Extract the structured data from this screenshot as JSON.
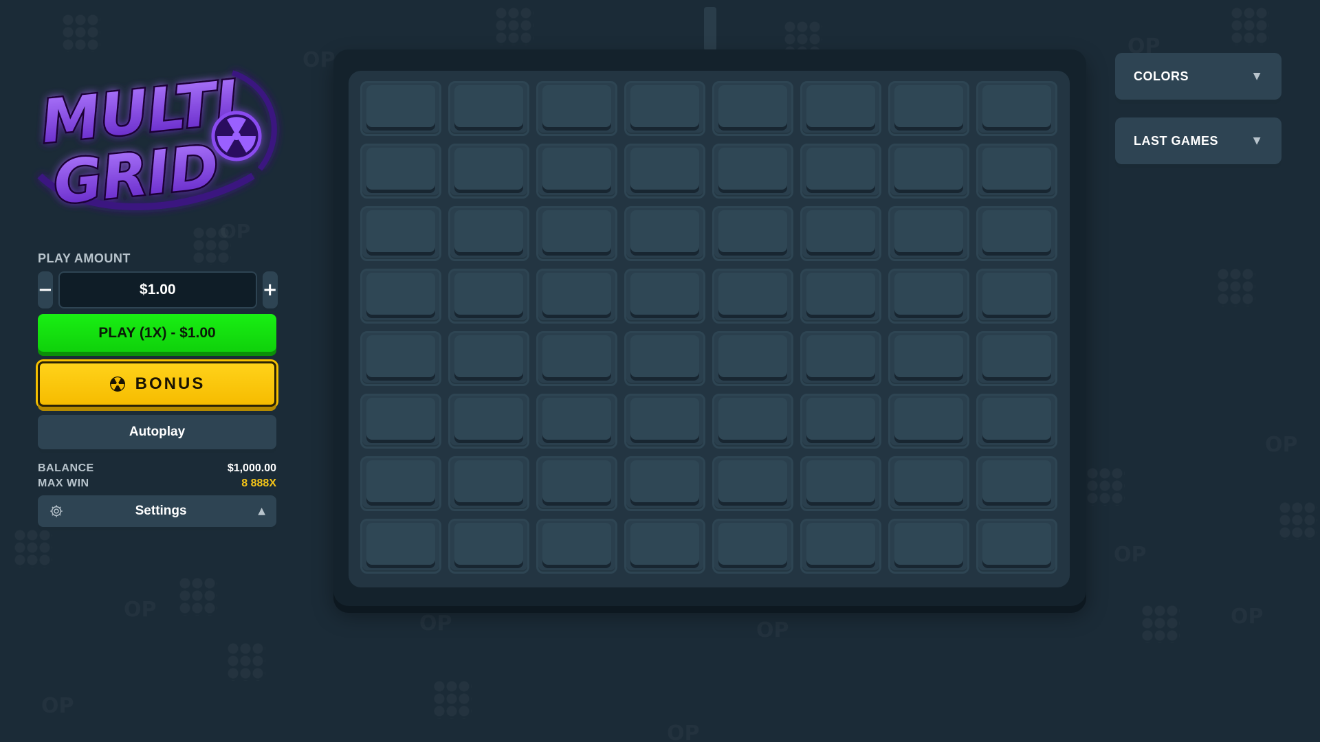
{
  "logo": {
    "line1": "MULTI",
    "line2": "GRID"
  },
  "left_panel": {
    "play_amount_label": "PLAY AMOUNT",
    "decrement_label": "−",
    "increment_label": "+",
    "amount_value": "$1.00",
    "play_button_label": "PLAY (1X) - $1.00",
    "bonus_button_label": "BONUS",
    "autoplay_button_label": "Autoplay",
    "balance_label": "BALANCE",
    "balance_value": "$1,000.00",
    "max_win_label": "MAX WIN",
    "max_win_value": "8 888X",
    "settings_label": "Settings",
    "settings_caret": "▲"
  },
  "right_panel": {
    "colors_label": "COLORS",
    "last_games_label": "LAST GAMES",
    "caret": "▼"
  },
  "board": {
    "rows": 8,
    "cols": 8
  },
  "colors": {
    "background": "#1b2b37",
    "play_green": "#19ef13",
    "bonus_yellow": "#ffd21a",
    "max_win_gold": "#f5c518",
    "logo_purple": "#7a3ee0"
  },
  "icons": {
    "bonus": "radiation-icon",
    "settings": "gear-icon",
    "dropdown": "chevron-down-icon"
  }
}
